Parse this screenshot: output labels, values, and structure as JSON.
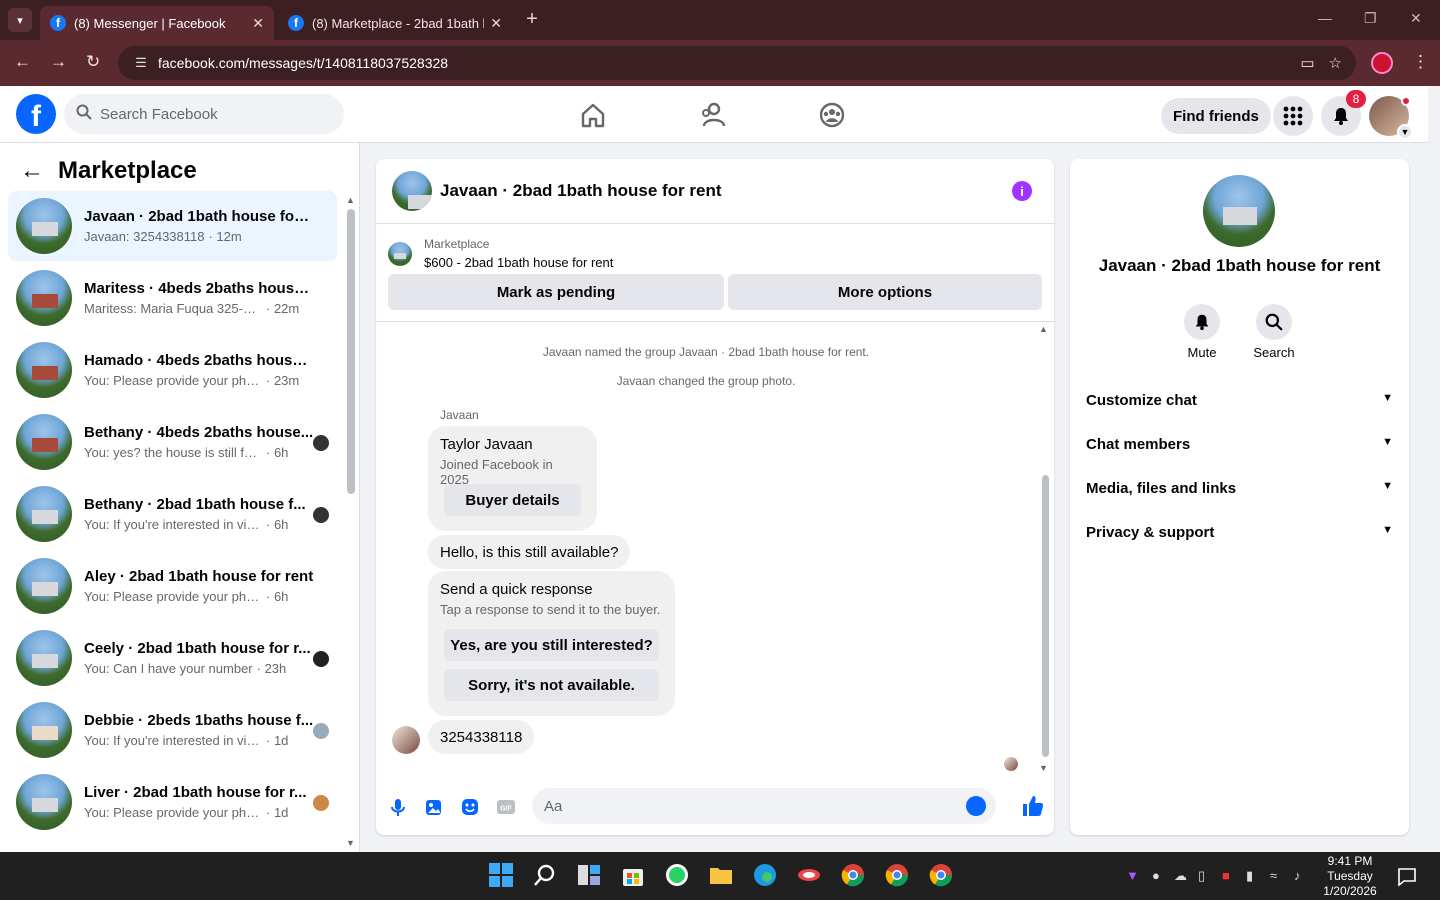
{
  "browser": {
    "tabs": [
      {
        "title": "(8) Messenger | Facebook",
        "active": true
      },
      {
        "title": "(8) Marketplace - 2bad 1bath h",
        "active": false
      }
    ],
    "url": "facebook.com/messages/t/1408118037528328"
  },
  "header": {
    "search_placeholder": "Search Facebook",
    "find_friends": "Find friends",
    "notifications_count": "8"
  },
  "sidebar": {
    "title": "Marketplace",
    "conversations": [
      {
        "name": "Javaan · 2bad 1bath house for rent",
        "preview": "Javaan: 3254338118",
        "time": "· 12m",
        "thumb": "gray"
      },
      {
        "name": "Maritess · 4beds 2baths house f...",
        "preview": "Maritess: Maria Fuqua 325-660/4...",
        "time": "· 22m",
        "thumb": "red"
      },
      {
        "name": "Hamado · 4beds 2baths house f...",
        "preview": "You: Please provide your phone n...",
        "time": "· 23m",
        "thumb": "red"
      },
      {
        "name": "Bethany · 4beds 2baths house...",
        "preview": "You: yes? the house is still for re...",
        "time": "· 6h",
        "thumb": "red"
      },
      {
        "name": "Bethany · 2bad 1bath house f...",
        "preview": "You: If you're interested in viewi...",
        "time": "· 6h",
        "thumb": "gray"
      },
      {
        "name": "Aley · 2bad 1bath house for rent",
        "preview": "You: Please provide your phone nu...",
        "time": "· 6h",
        "thumb": "gray"
      },
      {
        "name": "Ceely · 2bad 1bath house for r...",
        "preview": "You: Can I have your number",
        "time": "· 23h",
        "thumb": "gray"
      },
      {
        "name": "Debbie · 2beds 1baths house f...",
        "preview": "You: If you're interested in viewi...",
        "time": "· 1d",
        "thumb": "tan"
      },
      {
        "name": "Liver · 2bad 1bath house for r...",
        "preview": "You: Please provide your phone ...",
        "time": "· 1d",
        "thumb": "gray"
      }
    ]
  },
  "chat": {
    "title": "Javaan · 2bad 1bath house for rent",
    "marketplace_label": "Marketplace",
    "listing": "$600 - 2bad 1bath house for rent",
    "mark_pending": "Mark as pending",
    "more_options": "More options",
    "system_messages": [
      "Javaan named the group Javaan · 2bad 1bath house for rent.",
      "Javaan changed the group photo."
    ],
    "sender": "Javaan",
    "profile_card": {
      "name": "Taylor Javaan",
      "joined": "Joined Facebook in 2025",
      "button": "Buyer details"
    },
    "message1": "Hello, is this still available?",
    "quick": {
      "title": "Send a quick response",
      "subtitle": "Tap a response to send it to the buyer.",
      "options": [
        "Yes, are you still interested?",
        "Sorry, it's not available."
      ]
    },
    "message2": "3254338118",
    "composer_placeholder": "Aa"
  },
  "details": {
    "name": "Javaan · 2bad 1bath house for rent",
    "actions": [
      "Mute",
      "Search"
    ],
    "sections": [
      "Customize chat",
      "Chat members",
      "Media, files and links",
      "Privacy & support"
    ]
  },
  "taskbar": {
    "time": "9:41 PM",
    "day": "Tuesday",
    "date": "1/20/2026"
  },
  "colors": {
    "fb_blue": "#0866ff",
    "chrome_dark": "#3c1f22",
    "chrome_mid": "#5a2a30",
    "info_purple": "#a033ff",
    "badge_red": "#e41e3f",
    "selected_row": "#ebf5ff"
  }
}
